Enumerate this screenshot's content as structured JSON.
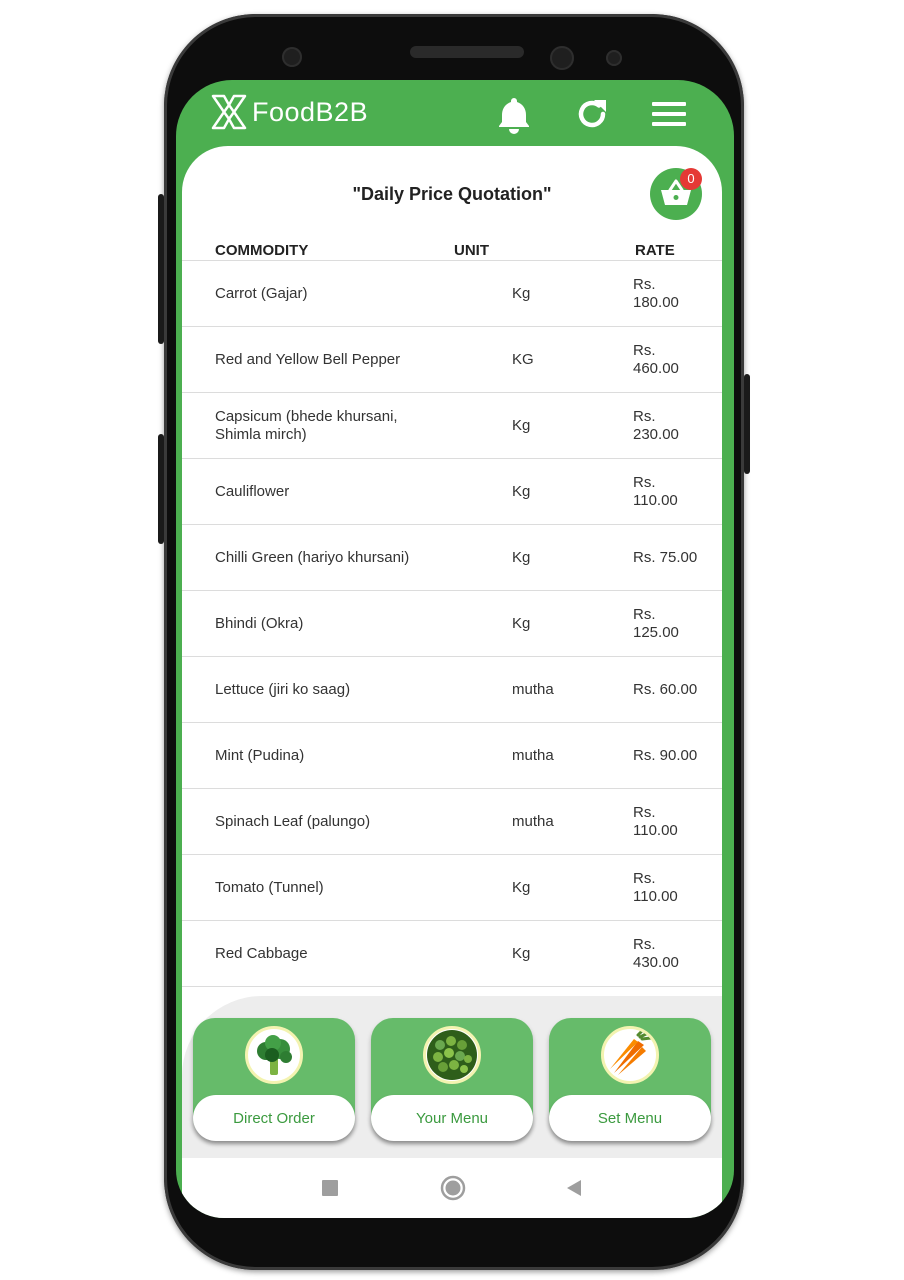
{
  "header": {
    "brand": "FoodB2B",
    "icons": [
      "bell-icon",
      "refresh-icon",
      "hamburger-menu-icon"
    ]
  },
  "page": {
    "title": "\"Daily Price Quotation\"",
    "cart_count": "0"
  },
  "table": {
    "headers": {
      "commodity": "COMMODITY",
      "unit": "UNIT",
      "rate": "RATE"
    },
    "rows": [
      {
        "name": "Carrot (Gajar)",
        "unit": "Kg",
        "rate": "Rs. 180.00"
      },
      {
        "name": "Red and Yellow Bell Pepper",
        "unit": "KG",
        "rate": "Rs. 460.00"
      },
      {
        "name": "Capsicum (bhede khursani, Shimla mirch)",
        "unit": "Kg",
        "rate": "Rs. 230.00"
      },
      {
        "name": "Cauliflower",
        "unit": "Kg",
        "rate": "Rs. 110.00"
      },
      {
        "name": "Chilli Green (hariyo khursani)",
        "unit": "Kg",
        "rate": "Rs. 75.00"
      },
      {
        "name": "Bhindi (Okra)",
        "unit": "Kg",
        "rate": "Rs. 125.00"
      },
      {
        "name": "Lettuce (jiri ko saag)",
        "unit": "mutha",
        "rate": "Rs. 60.00"
      },
      {
        "name": "Mint (Pudina)",
        "unit": "mutha",
        "rate": "Rs. 90.00"
      },
      {
        "name": "Spinach Leaf (palungo)",
        "unit": "mutha",
        "rate": "Rs. 110.00"
      },
      {
        "name": "Tomato (Tunnel)",
        "unit": "Kg",
        "rate": "Rs. 110.00"
      },
      {
        "name": "Red Cabbage",
        "unit": "Kg",
        "rate": "Rs. 430.00"
      }
    ]
  },
  "bottom_menu": [
    {
      "label": "Direct Order",
      "icon": "broccoli-icon"
    },
    {
      "label": "Your Menu",
      "icon": "peas-icon"
    },
    {
      "label": "Set Menu",
      "icon": "carrot-icon"
    }
  ],
  "colors": {
    "brand_green": "#4caf50",
    "tile_green": "#66bb6a",
    "badge_red": "#e53935"
  }
}
